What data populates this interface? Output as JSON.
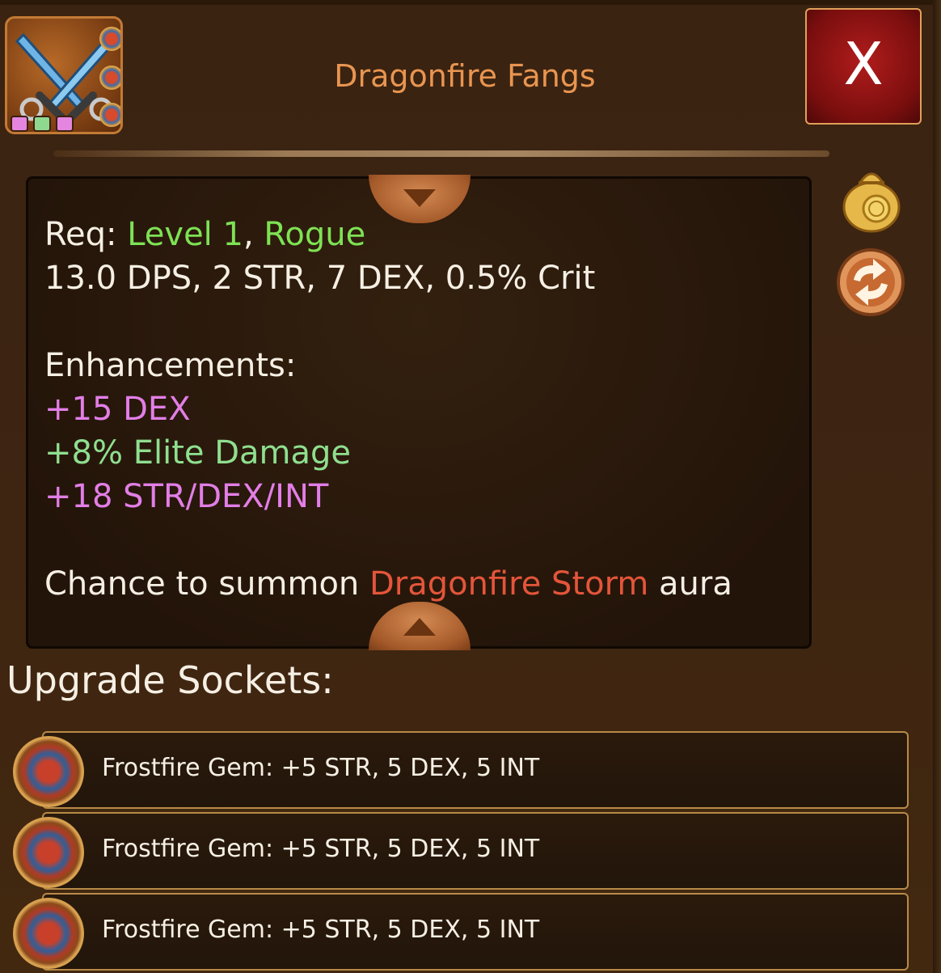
{
  "item": {
    "title": "Dragonfire Fangs",
    "icon": "crossed-daggers-icon",
    "socket_colors": [
      "#e486e0",
      "#8fd88f",
      "#e486e0"
    ]
  },
  "header": {
    "close_label": "X"
  },
  "description": {
    "req_label": "Req:",
    "req_level": "Level 1",
    "req_sep": ",",
    "req_class": "Rogue",
    "stats_line": "13.0 DPS, 2 STR, 7 DEX, 0.5% Crit",
    "enhancements_label": "Enhancements:",
    "enhancements": [
      {
        "text": "+15 DEX",
        "color": "#e27ee6"
      },
      {
        "text": "+8% Elite Damage",
        "color": "#8fdf8f"
      },
      {
        "text": "+18 STR/DEX/INT",
        "color": "#e27ee6"
      }
    ],
    "proc_prefix": "Chance to summon",
    "proc_name": "Dragonfire Storm",
    "proc_suffix": "aura"
  },
  "side_actions": [
    {
      "name": "sell-bag-icon"
    },
    {
      "name": "swap-icon"
    }
  ],
  "upgrade": {
    "title": "Upgrade Sockets:",
    "sockets": [
      {
        "text": "Frostfire Gem: +5 STR, 5 DEX, 5 INT"
      },
      {
        "text": "Frostfire Gem: +5 STR, 5 DEX, 5 INT"
      },
      {
        "text": "Frostfire Gem: +5 STR, 5 DEX, 5 INT"
      }
    ]
  }
}
